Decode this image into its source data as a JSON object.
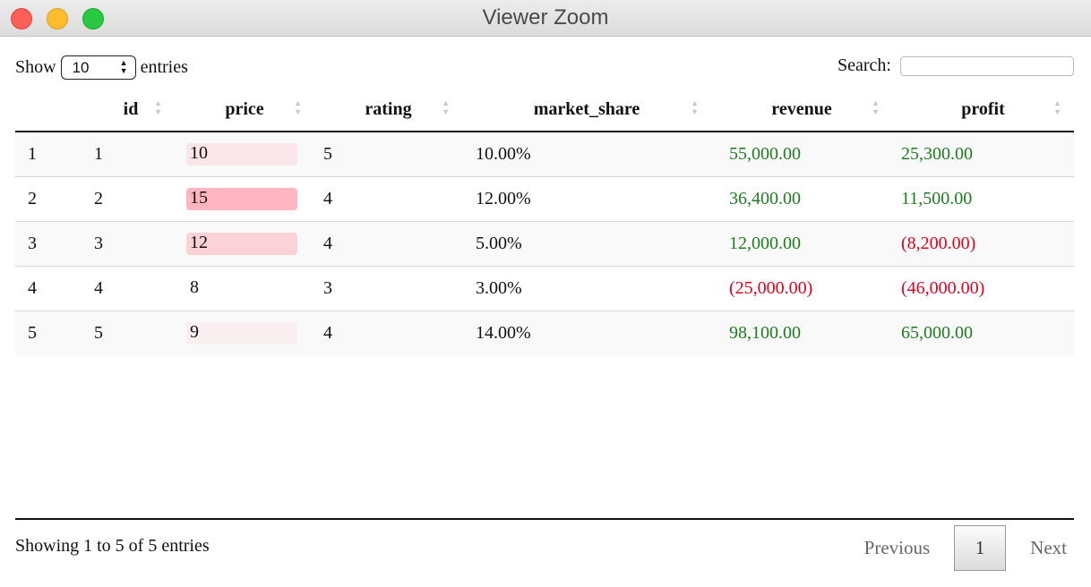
{
  "window": {
    "title": "Viewer Zoom"
  },
  "controls": {
    "show_label": "Show",
    "page_length": "10",
    "entries_label": "entries",
    "search_label": "Search:",
    "search_value": ""
  },
  "table": {
    "columns": [
      "",
      "id",
      "price",
      "rating",
      "market_share",
      "revenue",
      "profit"
    ],
    "price_max": 15,
    "colors": {
      "price_bar": "#ffb6c1",
      "positive": "#1f7d1f",
      "negative": "#e5001e"
    },
    "rows": [
      {
        "rownum": "1",
        "id": "1",
        "price": "10",
        "price_value": 10,
        "rating": "5",
        "market_share": "10.00%",
        "revenue": "55,000.00",
        "revenue_sign": "pos",
        "profit": "25,300.00",
        "profit_sign": "pos"
      },
      {
        "rownum": "2",
        "id": "2",
        "price": "15",
        "price_value": 15,
        "rating": "4",
        "market_share": "12.00%",
        "revenue": "36,400.00",
        "revenue_sign": "pos",
        "profit": "11,500.00",
        "profit_sign": "pos"
      },
      {
        "rownum": "3",
        "id": "3",
        "price": "12",
        "price_value": 12,
        "rating": "4",
        "market_share": "5.00%",
        "revenue": "12,000.00",
        "revenue_sign": "pos",
        "profit": "(8,200.00)",
        "profit_sign": "neg"
      },
      {
        "rownum": "4",
        "id": "4",
        "price": "8",
        "price_value": 8,
        "rating": "3",
        "market_share": "3.00%",
        "revenue": "(25,000.00)",
        "revenue_sign": "neg",
        "profit": "(46,000.00)",
        "profit_sign": "neg"
      },
      {
        "rownum": "5",
        "id": "5",
        "price": "9",
        "price_value": 9,
        "rating": "4",
        "market_share": "14.00%",
        "revenue": "98,100.00",
        "revenue_sign": "pos",
        "profit": "65,000.00",
        "profit_sign": "pos"
      }
    ]
  },
  "footer": {
    "info": "Showing 1 to 5 of 5 entries",
    "previous_label": "Previous",
    "current_page": "1",
    "next_label": "Next"
  }
}
